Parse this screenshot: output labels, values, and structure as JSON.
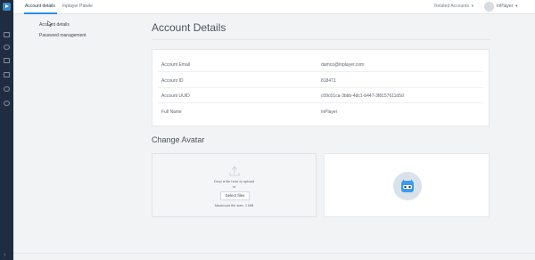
{
  "topbar": {
    "tabs": [
      {
        "label": "Account details",
        "active": true
      },
      {
        "label": "Inplayer Paiwle",
        "active": false
      }
    ],
    "related_label": "Related Accounts",
    "user_name": "InPlayer"
  },
  "subnav": {
    "items": [
      "Account details",
      "Password management"
    ]
  },
  "main": {
    "title": "Account Details",
    "rows": [
      {
        "label": "Account Email",
        "value": "damco@inplayer.com"
      },
      {
        "label": "Account ID",
        "value": "818471"
      },
      {
        "label": "Account UUID",
        "value": "c09c01ca-3bbb-4dc1-b447-3f8157611d5d"
      },
      {
        "label": "Full Name",
        "value": "InPlayer"
      }
    ],
    "avatar_title": "Change Avatar",
    "upload": {
      "drop_text": "Drop a file here to upload",
      "or_text": "or",
      "button_label": "Select files",
      "max_text": "Maximum file size: 1 MB"
    }
  },
  "colors": {
    "rail": "#1f2d3f",
    "accent": "#2f8de4",
    "avatar_bg": "#3d9be9"
  },
  "icons": {
    "logo": "play-logo-icon",
    "rail": [
      "dashboard-icon",
      "assets-icon",
      "analytics-icon",
      "reports-icon",
      "settings-icon",
      "user-icon",
      "expand-icon"
    ],
    "upload": "upload-icon",
    "avatar": "robot-avatar-icon"
  }
}
